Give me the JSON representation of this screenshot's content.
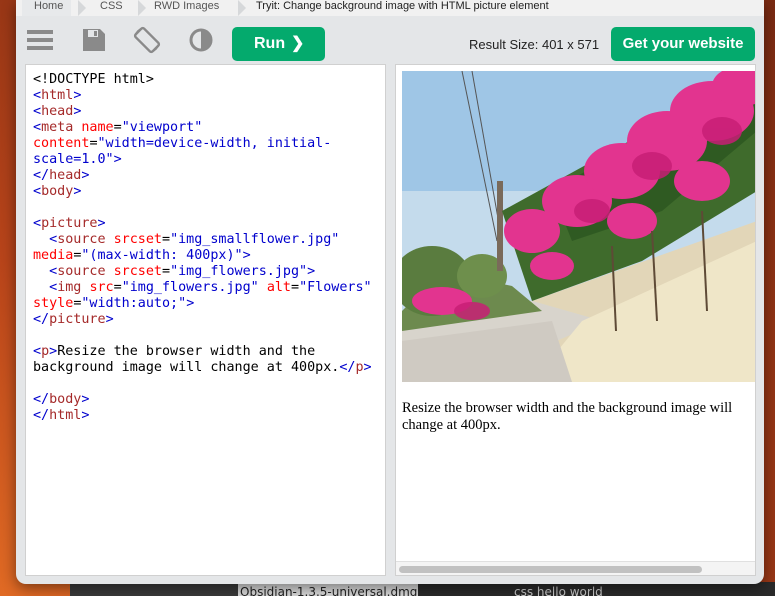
{
  "breadcrumb": {
    "home": "Home",
    "css": "CSS",
    "rwd": "RWD Images",
    "current": "Tryit: Change background image with HTML picture element"
  },
  "toolbar": {
    "run_label": "Run",
    "result_size": "Result Size: 401 x 571",
    "get_website_label": "Get your website"
  },
  "icons": [
    "menu-icon",
    "save-icon",
    "rotate-icon",
    "contrast-icon",
    "chevron-right-icon"
  ],
  "colors": {
    "accent": "#04aa6d",
    "tag": "#a52a2a",
    "bracket": "#0000cd",
    "attribute": "#ff0000"
  },
  "code_lines": [
    [
      [
        "t",
        "<!DOCTYPE html>"
      ]
    ],
    [
      [
        "b",
        "<"
      ],
      [
        "g",
        "html"
      ],
      [
        "b",
        ">"
      ]
    ],
    [
      [
        "b",
        "<"
      ],
      [
        "g",
        "head"
      ],
      [
        "b",
        ">"
      ]
    ],
    [
      [
        "b",
        "<"
      ],
      [
        "g",
        "meta"
      ],
      [
        "t",
        " "
      ],
      [
        "a",
        "name"
      ],
      [
        "t",
        "="
      ],
      [
        "v",
        "\"viewport\""
      ]
    ],
    [
      [
        "a",
        "content"
      ],
      [
        "t",
        "="
      ],
      [
        "v",
        "\"width=device-width, initial-"
      ]
    ],
    [
      [
        "v",
        "scale=1.0\""
      ],
      [
        "b",
        ">"
      ]
    ],
    [
      [
        "b",
        "</"
      ],
      [
        "g",
        "head"
      ],
      [
        "b",
        ">"
      ]
    ],
    [
      [
        "b",
        "<"
      ],
      [
        "g",
        "body"
      ],
      [
        "b",
        ">"
      ]
    ],
    [],
    [
      [
        "b",
        "<"
      ],
      [
        "g",
        "picture"
      ],
      [
        "b",
        ">"
      ]
    ],
    [
      [
        "t",
        "  "
      ],
      [
        "b",
        "<"
      ],
      [
        "g",
        "source"
      ],
      [
        "t",
        " "
      ],
      [
        "a",
        "srcset"
      ],
      [
        "t",
        "="
      ],
      [
        "v",
        "\"img_smallflower.jpg\""
      ]
    ],
    [
      [
        "a",
        "media"
      ],
      [
        "t",
        "="
      ],
      [
        "v",
        "\"(max-width: 400px)\""
      ],
      [
        "b",
        ">"
      ]
    ],
    [
      [
        "t",
        "  "
      ],
      [
        "b",
        "<"
      ],
      [
        "g",
        "source"
      ],
      [
        "t",
        " "
      ],
      [
        "a",
        "srcset"
      ],
      [
        "t",
        "="
      ],
      [
        "v",
        "\"img_flowers.jpg\""
      ],
      [
        "b",
        ">"
      ]
    ],
    [
      [
        "t",
        "  "
      ],
      [
        "b",
        "<"
      ],
      [
        "g",
        "img"
      ],
      [
        "t",
        " "
      ],
      [
        "a",
        "src"
      ],
      [
        "t",
        "="
      ],
      [
        "v",
        "\"img_flowers.jpg\""
      ],
      [
        "t",
        " "
      ],
      [
        "a",
        "alt"
      ],
      [
        "t",
        "="
      ],
      [
        "v",
        "\"Flowers\""
      ]
    ],
    [
      [
        "a",
        "style"
      ],
      [
        "t",
        "="
      ],
      [
        "v",
        "\"width:auto;\""
      ],
      [
        "b",
        ">"
      ]
    ],
    [
      [
        "b",
        "</"
      ],
      [
        "g",
        "picture"
      ],
      [
        "b",
        ">"
      ]
    ],
    [],
    [
      [
        "b",
        "<"
      ],
      [
        "g",
        "p"
      ],
      [
        "b",
        ">"
      ],
      [
        "t",
        "Resize the browser width and the"
      ]
    ],
    [
      [
        "t",
        "background image will change at 400px."
      ],
      [
        "b",
        "</"
      ],
      [
        "g",
        "p"
      ],
      [
        "b",
        ">"
      ]
    ],
    [],
    [
      [
        "b",
        "</"
      ],
      [
        "g",
        "body"
      ],
      [
        "b",
        ">"
      ]
    ],
    [
      [
        "b",
        "</"
      ],
      [
        "g",
        "html"
      ],
      [
        "b",
        ">"
      ]
    ]
  ],
  "result": {
    "paragraph": "Resize the browser width and the background image will change at 400px."
  },
  "taskbar": {
    "file_label": "Obsidian-1.3.5-universal.dmg",
    "right_label": "css hello world"
  }
}
